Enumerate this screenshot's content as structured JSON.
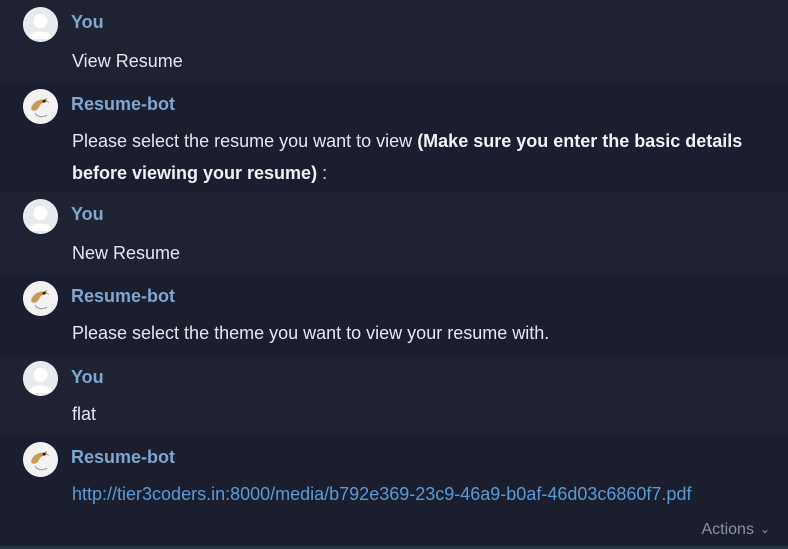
{
  "messages": [
    {
      "author": "You",
      "text": "View Resume"
    },
    {
      "author": "Resume-bot",
      "text_plain": "Please select the resume you want to view ",
      "text_bold": "(Make sure you enter the basic details",
      "text_bold2": "before viewing your resume)",
      "text_tail": " :"
    },
    {
      "author": "You",
      "text": "New Resume"
    },
    {
      "author": "Resume-bot",
      "text": "Please select the theme you want to view your resume with."
    },
    {
      "author": "You",
      "text": "flat"
    },
    {
      "author": "Resume-bot",
      "link": "http://tier3coders.in:8000/media/b792e369-23c9-46a9-b0af-46d03c6860f7.pdf"
    }
  ],
  "footer": {
    "actions_label": "Actions",
    "actions_icon": "chevron-down-icon"
  },
  "colors": {
    "background": "#1e2233",
    "author": "#7fa6cf",
    "link": "#5b9bd5"
  }
}
